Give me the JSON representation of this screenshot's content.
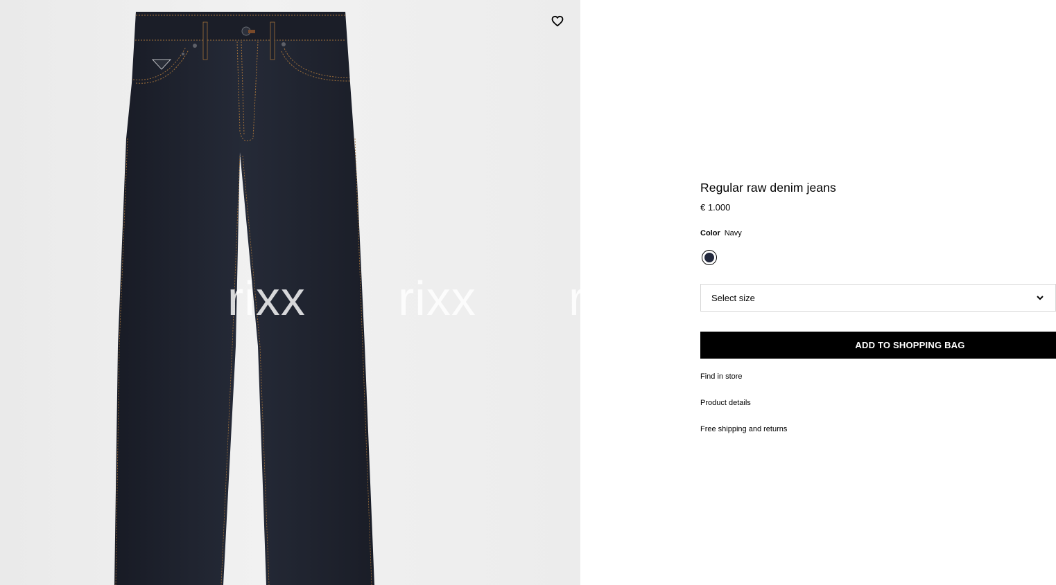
{
  "product": {
    "title": "Regular raw denim jeans",
    "price": "€ 1.000",
    "color_label": "Color",
    "color_value": "Navy",
    "swatch_color": "#23293d",
    "size_placeholder": "Select size",
    "add_to_bag": "ADD TO SHOPPING BAG",
    "links": [
      "Find in store",
      "Product details",
      "Free shipping and returns"
    ]
  },
  "watermark": [
    "rixx",
    "rixx",
    "rixx"
  ],
  "icons": {
    "wishlist": "heart-icon",
    "size_dropdown": "chevron-down-icon"
  },
  "colors": {
    "denim": "#1f222d",
    "stitching": "#a0703a",
    "button_bg": "#000000",
    "gallery_bg": "#ececec"
  }
}
